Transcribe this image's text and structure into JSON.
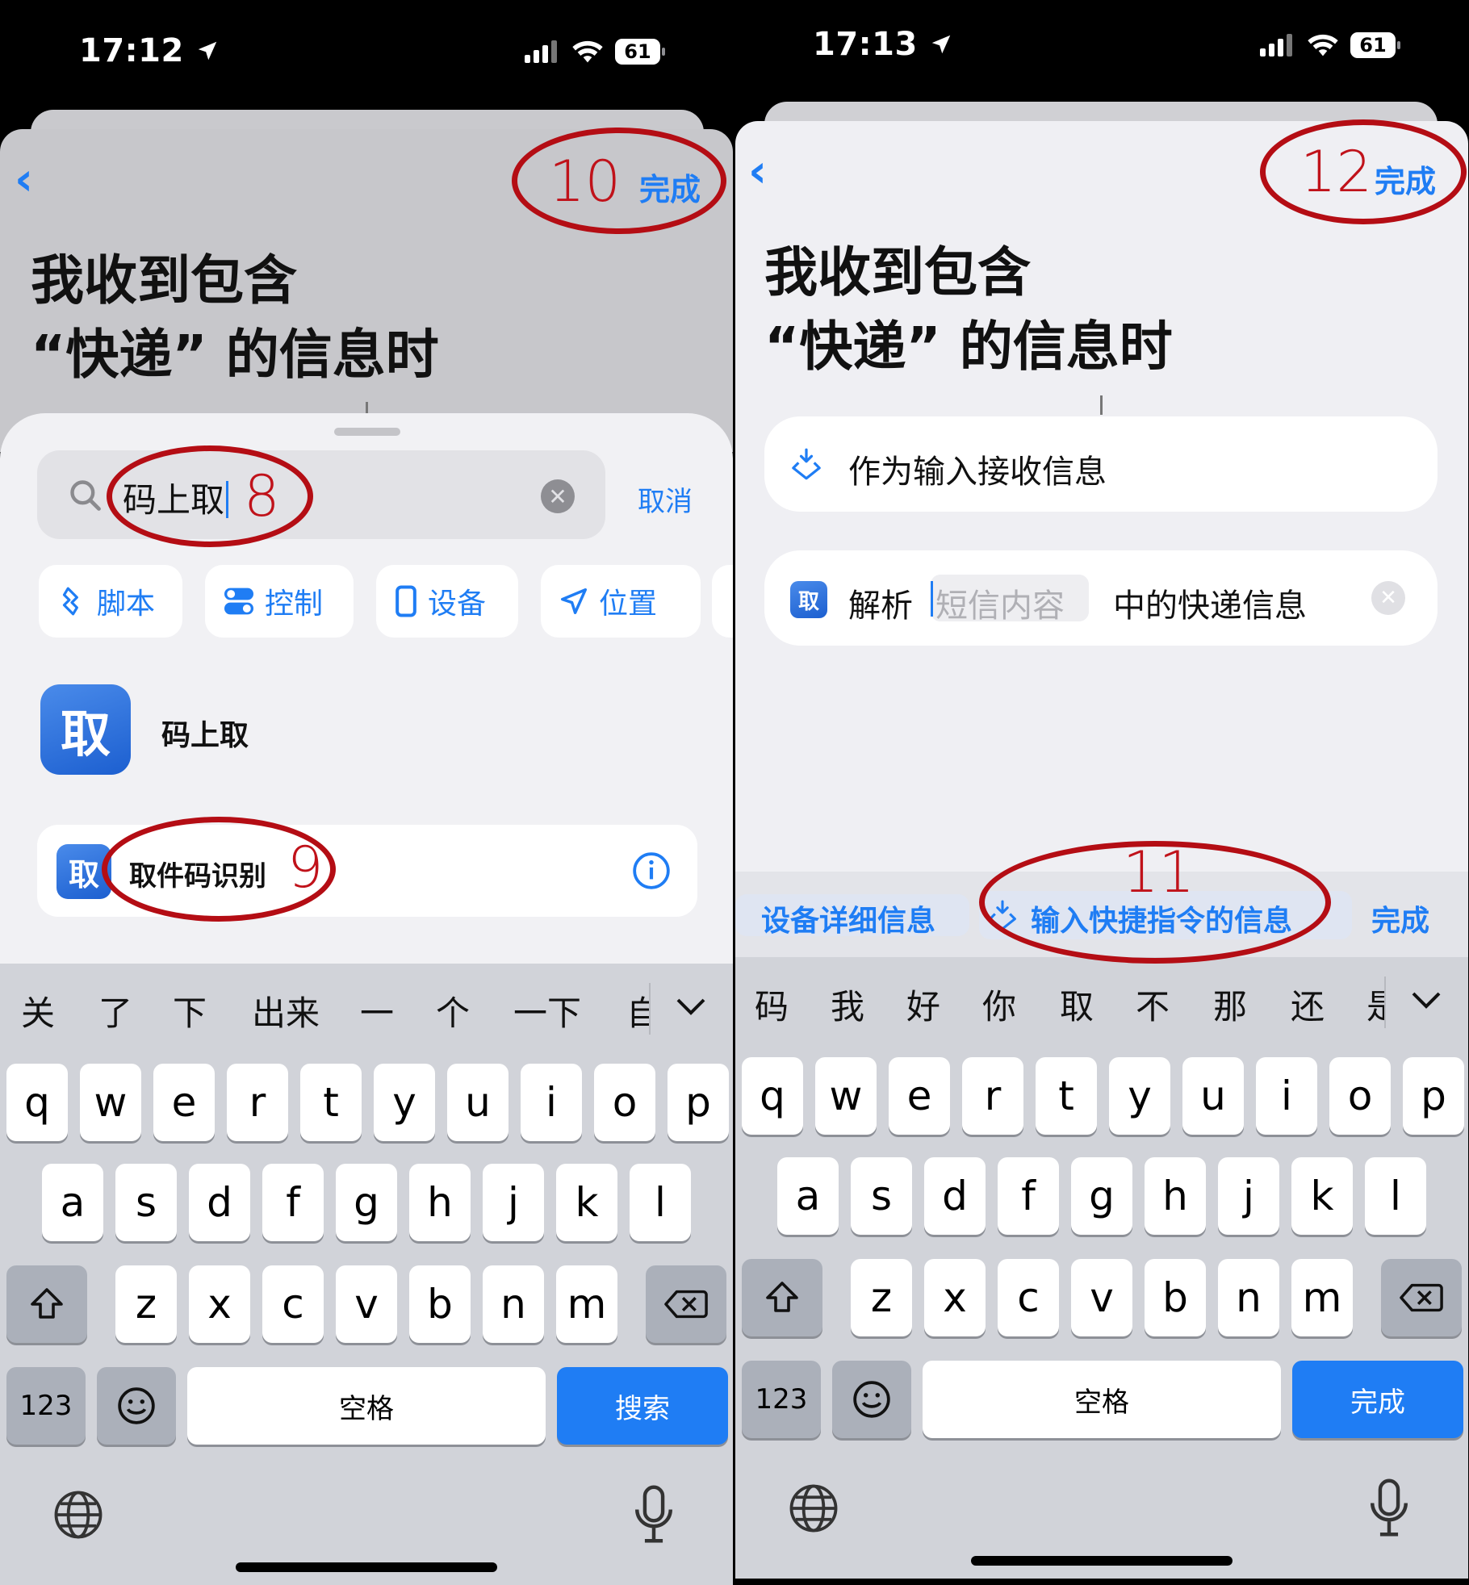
{
  "left": {
    "status": {
      "time": "17:12",
      "battery": "61"
    },
    "nav": {
      "done": "完成"
    },
    "title_lines": [
      "我收到包含",
      "“快递” 的信息时"
    ],
    "search": {
      "query": "码上取",
      "cancel": "取消"
    },
    "chips": [
      {
        "label": "脚本",
        "icon": "script-icon"
      },
      {
        "label": "控制",
        "icon": "toggle-icon"
      },
      {
        "label": "设备",
        "icon": "phone-icon"
      },
      {
        "label": "位置",
        "icon": "location-arrow-icon"
      }
    ],
    "app_result": {
      "name": "码上取",
      "icon_text": "取"
    },
    "action_result": {
      "name": "取件码识别",
      "icon_text": "取"
    },
    "keyboard": {
      "candidates": [
        "关",
        "了",
        "下",
        "出来",
        "一",
        "个",
        "一下",
        "自"
      ],
      "row1": [
        "q",
        "w",
        "e",
        "r",
        "t",
        "y",
        "u",
        "i",
        "o",
        "p"
      ],
      "row2": [
        "a",
        "s",
        "d",
        "f",
        "g",
        "h",
        "j",
        "k",
        "l"
      ],
      "row3": [
        "z",
        "x",
        "c",
        "v",
        "b",
        "n",
        "m"
      ],
      "num": "123",
      "space": "空格",
      "action": "搜索"
    },
    "annotations": {
      "search": "8",
      "action": "9",
      "done": "10"
    }
  },
  "right": {
    "status": {
      "time": "17:13",
      "battery": "61"
    },
    "nav": {
      "done": "完成"
    },
    "title_lines": [
      "我收到包含",
      "“快递” 的信息时"
    ],
    "action1": {
      "label": "作为输入接收信息"
    },
    "action2": {
      "verb": "解析",
      "param": "短信内容",
      "rest": "中的快递信息",
      "icon_text": "取"
    },
    "toolbar": {
      "item1": "设备详细信息",
      "item2": "输入快捷指令的信息",
      "done": "完成"
    },
    "keyboard": {
      "candidates": [
        "码",
        "我",
        "好",
        "你",
        "取",
        "不",
        "那",
        "还",
        "是"
      ],
      "row1": [
        "q",
        "w",
        "e",
        "r",
        "t",
        "y",
        "u",
        "i",
        "o",
        "p"
      ],
      "row2": [
        "a",
        "s",
        "d",
        "f",
        "g",
        "h",
        "j",
        "k",
        "l"
      ],
      "row3": [
        "z",
        "x",
        "c",
        "v",
        "b",
        "n",
        "m"
      ],
      "num": "123",
      "space": "空格",
      "action": "完成"
    },
    "annotations": {
      "toolbar": "11",
      "done": "12"
    }
  },
  "colors": {
    "accent": "#1f7df4",
    "annotation": "#b40d14"
  }
}
